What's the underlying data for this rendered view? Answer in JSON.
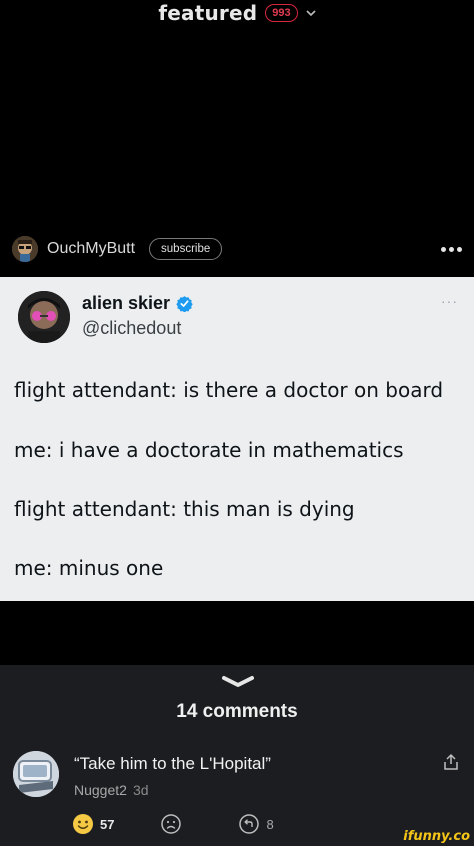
{
  "header": {
    "title": "featured",
    "count": "993"
  },
  "poster": {
    "name": "OuchMyButt",
    "subscribe_label": "subscribe"
  },
  "tweet": {
    "display_name": "alien skier",
    "handle": "@clichedout",
    "more": "···",
    "lines": [
      "flight attendant: is there a doctor on board",
      "me: i have a doctorate in mathematics",
      "flight attendant: this man is dying",
      "me: minus one"
    ],
    "verified_color": "#1d9bf0"
  },
  "comments": {
    "title": "14 comments",
    "items": [
      {
        "text": "“Take him to the L'Hopital”",
        "author": "Nugget2",
        "age": "3d",
        "reaction_count": "57",
        "reply_count": "8"
      }
    ]
  },
  "watermark": "ifunny.co",
  "colors": {
    "badge": "#d7263d",
    "panel": "#1c1d21",
    "card": "#eceef0"
  }
}
